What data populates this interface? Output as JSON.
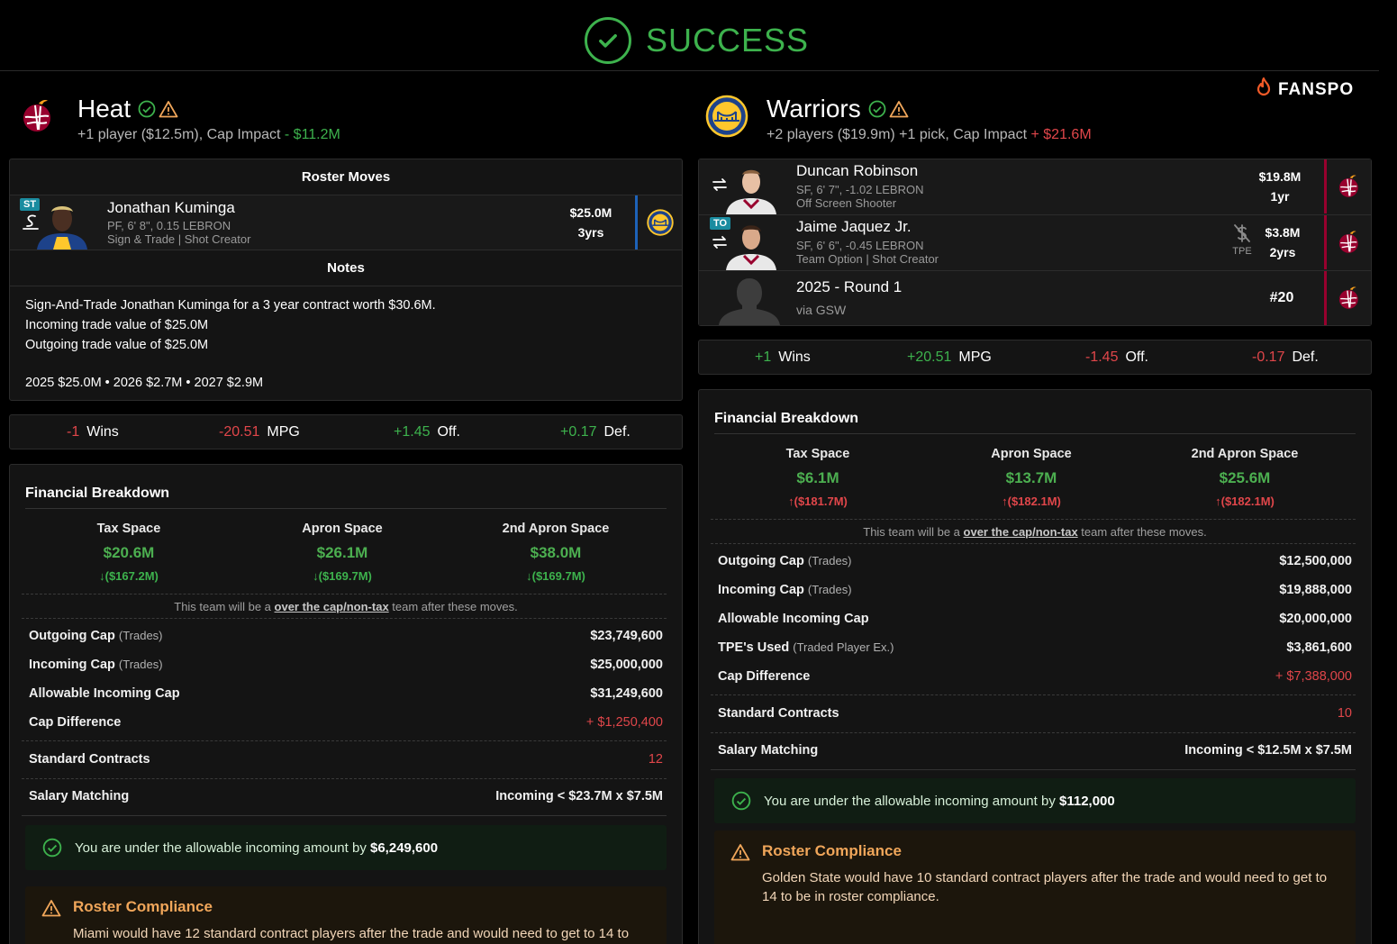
{
  "header": {
    "status": "SUCCESS"
  },
  "brand": {
    "name": "FANSPO"
  },
  "colors": {
    "success": "#3db24d",
    "negative": "#e0464a",
    "warning": "#f0a65a",
    "teal_tag": "#1a8ca0"
  },
  "left": {
    "team": "Heat",
    "summary_prefix": "+1 player ($12.5m), Cap Impact",
    "cap_impact": "- $11.2M",
    "roster": {
      "title": "Roster Moves",
      "player": {
        "tag": "ST",
        "name": "Jonathan Kuminga",
        "info": "PF, 6' 8\", 0.15 LEBRON",
        "role": "Sign & Trade | Shot Creator",
        "salary": "$25.0M",
        "years": "3yrs",
        "dest_icon": "warriors-logo-icon"
      }
    },
    "notes": {
      "title": "Notes",
      "lines": [
        "Sign-And-Trade Jonathan Kuminga for a 3 year contract worth $30.6M.",
        "Incoming trade value of $25.0M",
        "Outgoing trade value of $25.0M"
      ],
      "schedule": "2025 $25.0M • 2026 $2.7M • 2027 $2.9M"
    },
    "impact": {
      "wins_val": "-1",
      "wins_lbl": "Wins",
      "mpg_val": "-20.51",
      "mpg_lbl": "MPG",
      "off_val": "+1.45",
      "off_lbl": "Off.",
      "def_val": "+0.17",
      "def_lbl": "Def."
    },
    "financial": {
      "title": "Financial Breakdown",
      "spaces": [
        {
          "label": "Tax Space",
          "value": "$20.6M",
          "delta": "($167.2M)"
        },
        {
          "label": "Apron Space",
          "value": "$26.1M",
          "delta": "($169.7M)"
        },
        {
          "label": "2nd Apron Space",
          "value": "$38.0M",
          "delta": "($169.7M)"
        }
      ],
      "note_pre": "This team will be a",
      "note_link": "over the cap/non-tax",
      "note_post": "team after these moves.",
      "rows": {
        "outgoing_k": "Outgoing Cap",
        "outgoing_s": "(Trades)",
        "outgoing_v": "$23,749,600",
        "incoming_k": "Incoming Cap",
        "incoming_s": "(Trades)",
        "incoming_v": "$25,000,000",
        "allow_k": "Allowable Incoming Cap",
        "allow_v": "$31,249,600",
        "diff_k": "Cap Difference",
        "diff_v": "+ $1,250,400",
        "std_k": "Standard Contracts",
        "std_v": "12",
        "match_k": "Salary Matching",
        "match_v": "Incoming < $23.7M x $7.5M"
      },
      "ok_text": "You are under the allowable incoming amount by",
      "ok_amount": "$6,249,600",
      "warn_title": "Roster Compliance",
      "warn_text": "Miami would have 12 standard contract players after the trade and would need to get to 14 to"
    }
  },
  "right": {
    "team": "Warriors",
    "summary_prefix": "+2 players ($19.9m) +1 pick, Cap Impact",
    "cap_impact": "+ $21.6M",
    "players": [
      {
        "name": "Duncan Robinson",
        "info": "SF, 6' 7\", -1.02 LEBRON",
        "role": "Off Screen Shooter",
        "salary": "$19.8M",
        "years": "1yr"
      },
      {
        "tag": "TO",
        "name": "Jaime Jaquez Jr.",
        "info": "SF, 6' 6\", -0.45 LEBRON",
        "role": "Team Option | Shot Creator",
        "tpe": "TPE",
        "salary": "$3.8M",
        "years": "2yrs"
      },
      {
        "name": "2025 - Round 1",
        "info": "via GSW",
        "pick": "#20"
      }
    ],
    "impact": {
      "wins_val": "+1",
      "wins_lbl": "Wins",
      "mpg_val": "+20.51",
      "mpg_lbl": "MPG",
      "off_val": "-1.45",
      "off_lbl": "Off.",
      "def_val": "-0.17",
      "def_lbl": "Def."
    },
    "financial": {
      "title": "Financial Breakdown",
      "spaces": [
        {
          "label": "Tax Space",
          "value": "$6.1M",
          "delta": "($181.7M)"
        },
        {
          "label": "Apron Space",
          "value": "$13.7M",
          "delta": "($182.1M)"
        },
        {
          "label": "2nd Apron Space",
          "value": "$25.6M",
          "delta": "($182.1M)"
        }
      ],
      "note_pre": "This team will be a",
      "note_link": "over the cap/non-tax",
      "note_post": "team after these moves.",
      "rows": {
        "outgoing_k": "Outgoing Cap",
        "outgoing_s": "(Trades)",
        "outgoing_v": "$12,500,000",
        "incoming_k": "Incoming Cap",
        "incoming_s": "(Trades)",
        "incoming_v": "$19,888,000",
        "allow_k": "Allowable Incoming Cap",
        "allow_v": "$20,000,000",
        "tpe_k": "TPE's Used",
        "tpe_s": "(Traded Player Ex.)",
        "tpe_v": "$3,861,600",
        "diff_k": "Cap Difference",
        "diff_v": "+ $7,388,000",
        "std_k": "Standard Contracts",
        "std_v": "10",
        "match_k": "Salary Matching",
        "match_v": "Incoming < $12.5M x $7.5M"
      },
      "ok_text": "You are under the allowable incoming amount by",
      "ok_amount": "$112,000",
      "warn_title": "Roster Compliance",
      "warn_text": "Golden State would have 10 standard contract players after the trade and would need to get to 14 to be in roster compliance."
    }
  }
}
